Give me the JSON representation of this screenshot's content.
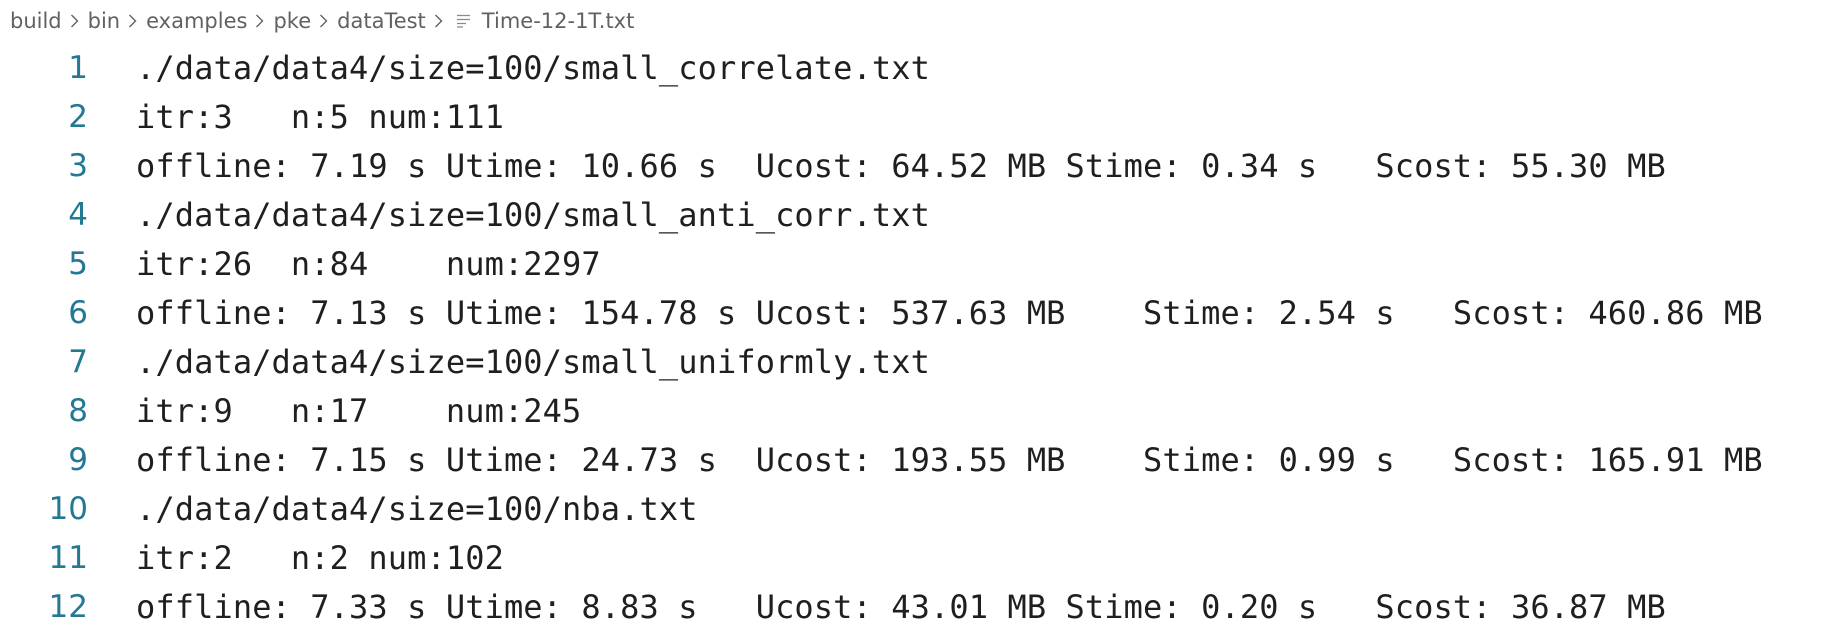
{
  "breadcrumb": {
    "items": [
      "build",
      "bin",
      "examples",
      "pke",
      "dataTest"
    ],
    "file_icon": "text-file-icon",
    "file": "Time-12-1T.txt"
  },
  "editor": {
    "lines": [
      {
        "number": "1",
        "text": "./data/data4/size=100/small_correlate.txt"
      },
      {
        "number": "2",
        "text": "itr:3   n:5 num:111"
      },
      {
        "number": "3",
        "text": "offline: 7.19 s Utime: 10.66 s  Ucost: 64.52 MB Stime: 0.34 s   Scost: 55.30 MB"
      },
      {
        "number": "4",
        "text": "./data/data4/size=100/small_anti_corr.txt"
      },
      {
        "number": "5",
        "text": "itr:26  n:84    num:2297"
      },
      {
        "number": "6",
        "text": "offline: 7.13 s Utime: 154.78 s Ucost: 537.63 MB    Stime: 2.54 s   Scost: 460.86 MB"
      },
      {
        "number": "7",
        "text": "./data/data4/size=100/small_uniformly.txt"
      },
      {
        "number": "8",
        "text": "itr:9   n:17    num:245"
      },
      {
        "number": "9",
        "text": "offline: 7.15 s Utime: 24.73 s  Ucost: 193.55 MB    Stime: 0.99 s   Scost: 165.91 MB"
      },
      {
        "number": "10",
        "text": "./data/data4/size=100/nba.txt"
      },
      {
        "number": "11",
        "text": "itr:2   n:2 num:102"
      },
      {
        "number": "12",
        "text": "offline: 7.33 s Utime: 8.83 s   Ucost: 43.01 MB Stime: 0.20 s   Scost: 36.87 MB"
      }
    ]
  },
  "colors": {
    "line_number": "#237893",
    "text": "#1f1f1f",
    "breadcrumb": "#616161",
    "background": "#ffffff"
  }
}
